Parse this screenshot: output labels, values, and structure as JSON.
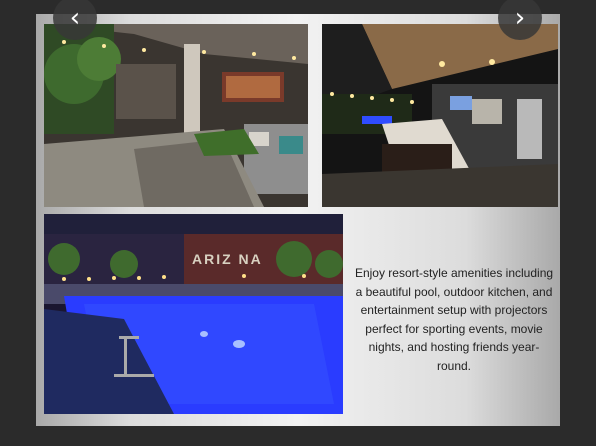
{
  "slideshow": {
    "prev_icon": "chevron-left-icon",
    "next_icon": "chevron-right-icon",
    "prev_glyph": "‹",
    "next_glyph": "›",
    "description": "Enjoy resort-style amenities including a beautiful pool, outdoor kitchen, and entertainment setup with projectors perfect for sporting events, movie nights, and hosting friends year-round.",
    "photos": [
      {
        "subject": "covered patio with lounge seating"
      },
      {
        "subject": "outdoor kitchen bar at night"
      },
      {
        "subject": "lit swimming pool at night"
      }
    ],
    "pool_sign_text": "ARIZ NA"
  },
  "colors": {
    "background": "#2b2b2b",
    "card": "#e6e6e6",
    "pool_blue": "#2a3cff",
    "nav_button": "#373737"
  }
}
